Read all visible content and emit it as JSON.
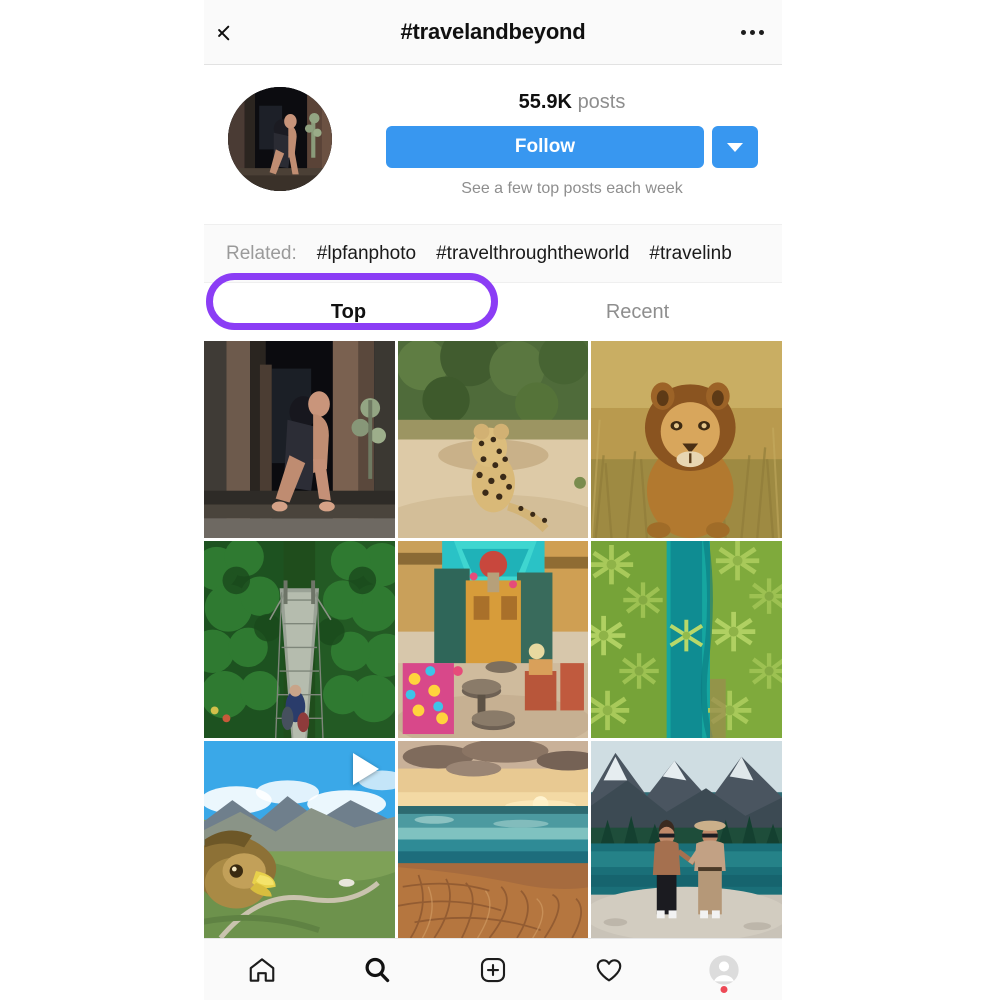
{
  "header": {
    "title": "#travelandbeyond",
    "back_icon": "chevron-left-icon",
    "more_icon": "ellipsis-icon"
  },
  "profile": {
    "avatar_alt": "hashtag-avatar",
    "posts_count": "55.9K",
    "posts_label": "posts",
    "follow_label": "Follow",
    "follow_caret_icon": "chevron-down-icon",
    "follow_subtitle": "See a few top posts each week",
    "follow_color": "#3897f0"
  },
  "related": {
    "label": "Related:",
    "tags": [
      "#lpfanphoto",
      "#travelthroughtheworld",
      "#travelinb"
    ]
  },
  "tabs": {
    "active": "Top",
    "items": [
      {
        "label": "Top",
        "state": "active"
      },
      {
        "label": "Recent",
        "state": "inactive"
      }
    ],
    "highlight_color": "#8b3df5"
  },
  "grid": {
    "posts": [
      {
        "name": "post-couple-cabin-doorway",
        "is_video": false
      },
      {
        "name": "post-leopard-on-sand",
        "is_video": false
      },
      {
        "name": "post-lion-in-grass",
        "is_video": false
      },
      {
        "name": "post-suspension-bridge-forest",
        "is_video": false
      },
      {
        "name": "post-colorful-courtyard-cafe",
        "is_video": false
      },
      {
        "name": "post-aerial-palms-turquoise-river",
        "is_video": false
      },
      {
        "name": "post-eagle-over-mountains",
        "is_video": true
      },
      {
        "name": "post-sunset-beach-sand-ripples",
        "is_video": false
      },
      {
        "name": "post-couple-mountain-lake",
        "is_video": false
      }
    ]
  },
  "bottomnav": {
    "items": [
      {
        "name": "home-icon",
        "label": "Home"
      },
      {
        "name": "search-icon",
        "label": "Search"
      },
      {
        "name": "add-post-icon",
        "label": "New Post"
      },
      {
        "name": "heart-icon",
        "label": "Activity"
      },
      {
        "name": "profile-avatar-icon",
        "label": "Profile"
      }
    ],
    "badge_color": "#ed4956"
  }
}
